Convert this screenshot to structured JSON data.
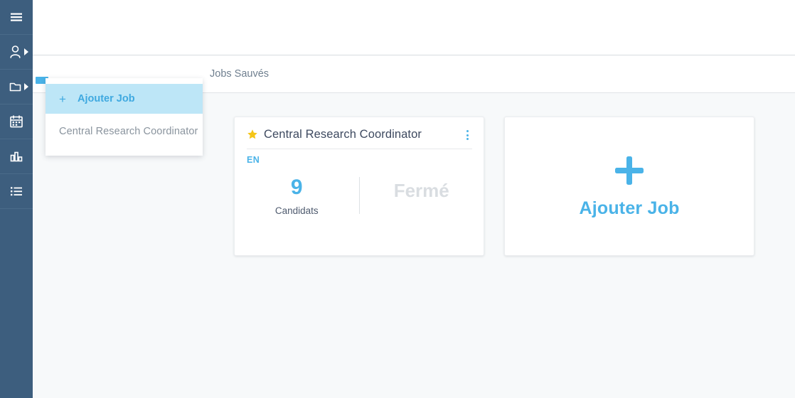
{
  "theme": {
    "sidebar_bg": "#3d5e7e",
    "accent_blue": "#4ab3e8",
    "highlight_blue": "#bde6f7",
    "page_bg": "#f7f9fa",
    "star_gold": "#f5c518",
    "muted_text": "#8a949e"
  },
  "sidebar": {
    "items": [
      {
        "icon": "hamburger-menu-icon",
        "has_arrow": false
      },
      {
        "icon": "person-icon",
        "has_arrow": true
      },
      {
        "icon": "folder-icon",
        "has_arrow": true
      },
      {
        "icon": "calendar-icon",
        "has_arrow": false
      },
      {
        "icon": "bar-chart-icon",
        "has_arrow": false
      },
      {
        "icon": "list-icon",
        "has_arrow": false
      }
    ]
  },
  "tabs": [
    {
      "label": "Jobs Sauvés",
      "active": false
    }
  ],
  "dropdown": {
    "items": [
      {
        "label": "Ajouter Job",
        "icon": "plus-icon",
        "active": true
      },
      {
        "label": "Central Research Coordinator",
        "icon": null,
        "active": false
      }
    ]
  },
  "job_card": {
    "star_icon": "star-icon",
    "title": "Central Research Coordinator",
    "menu_icon": "kebab-menu-icon",
    "language": "EN",
    "candidates_count": "9",
    "candidates_label": "Candidats",
    "status": "Fermé"
  },
  "add_card": {
    "plus_icon": "plus-icon",
    "label": "Ajouter Job"
  }
}
